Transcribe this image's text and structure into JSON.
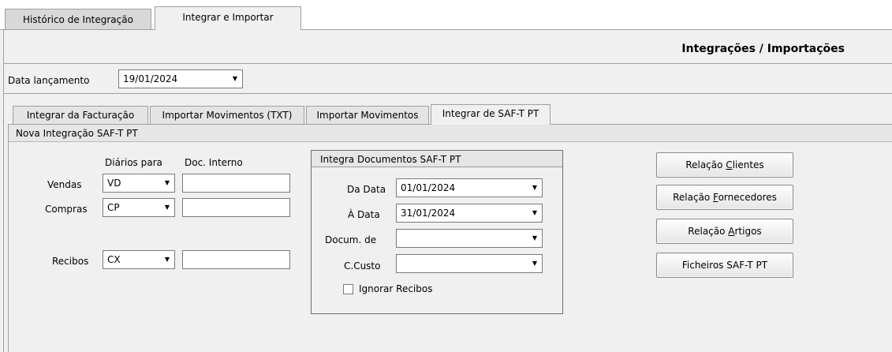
{
  "outer_tabs": [
    {
      "label": "Histórico de Integração"
    },
    {
      "label": "Integrar e Importar"
    }
  ],
  "header_title": "Integrações / Importações",
  "data_lancamento": {
    "label": "Data lançamento",
    "value": "19/01/2024"
  },
  "inner_tabs": [
    {
      "label": "Integrar da Facturação"
    },
    {
      "label": "Importar Movimentos (TXT)"
    },
    {
      "label": "Importar Movimentos"
    },
    {
      "label": "Integrar de SAF-T PT"
    }
  ],
  "section_title": "Nova Integração SAF-T PT",
  "columns": {
    "diarios": "Diários para",
    "doc_interno": "Doc. Interno"
  },
  "rows": {
    "vendas": {
      "label": "Vendas",
      "diario": "VD",
      "doc": ""
    },
    "compras": {
      "label": "Compras",
      "diario": "CP",
      "doc": ""
    },
    "recibos": {
      "label": "Recibos",
      "diario": "CX",
      "doc": ""
    }
  },
  "docs_box": {
    "title": "Integra Documentos SAF-T PT",
    "da_data": {
      "label": "Da Data",
      "value": "01/01/2024"
    },
    "a_data": {
      "label": "À Data",
      "value": "31/01/2024"
    },
    "docum_de": {
      "label": "Docum. de",
      "value": ""
    },
    "c_custo": {
      "label": "C.Custo",
      "value": ""
    },
    "ignorar": {
      "label": "Ignorar Recibos",
      "checked": false
    }
  },
  "buttons": {
    "clientes": {
      "pre": "Relação ",
      "key": "C",
      "post": "lientes"
    },
    "fornecedores": {
      "pre": "Relação ",
      "key": "F",
      "post": "ornecedores"
    },
    "artigos": {
      "pre": "Relação ",
      "key": "A",
      "post": "rtigos"
    },
    "ficheiros": {
      "label": "Ficheiros SAF-T PT"
    }
  },
  "icons": {
    "dropdown": "chevron-down-icon",
    "checkbox": "checkbox-icon"
  }
}
